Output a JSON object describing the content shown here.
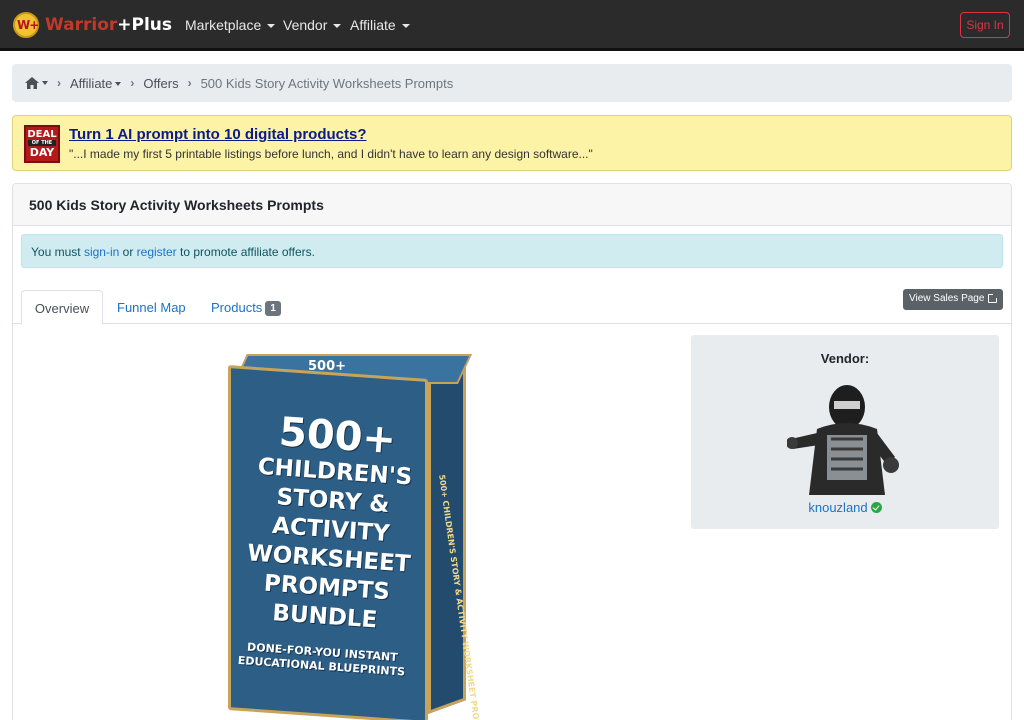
{
  "navbar": {
    "logo_mark": "W+",
    "brand_name": "Warrior",
    "brand_plus": "+Plus",
    "menu": [
      {
        "label": "Marketplace"
      },
      {
        "label": "Vendor"
      },
      {
        "label": "Affiliate"
      }
    ],
    "sign_in": "Sign In"
  },
  "breadcrumb": {
    "items": [
      {
        "label": "Affiliate"
      },
      {
        "label": "Offers"
      }
    ],
    "current": "500 Kids Story Activity Worksheets Prompts"
  },
  "deal": {
    "badge_line1": "DEAL",
    "badge_line2": "OF THE",
    "badge_line3": "DAY",
    "title": "Turn 1 AI prompt into 10 digital products?",
    "quote": "\"...I made my first 5 printable listings before lunch, and I didn't have to learn any design software...\""
  },
  "offer": {
    "title": "500 Kids Story Activity Worksheets Prompts",
    "alert_prefix": "You must",
    "alert_signin": "sign-in",
    "alert_or": "or",
    "alert_register": "register",
    "alert_suffix": "to promote affiliate offers.",
    "tabs": [
      {
        "label": "Overview",
        "active": true
      },
      {
        "label": "Funnel Map"
      },
      {
        "label": "Products",
        "badge": "1"
      }
    ],
    "view_sales_page": "View Sales Page"
  },
  "product_image": {
    "top_label": "500+",
    "number": "500+",
    "lines": [
      "CHILDREN'S",
      "STORY &",
      "ACTIVITY",
      "WORKSHEET",
      "PROMPTS",
      "BUNDLE"
    ],
    "subtitle_1": "DONE-FOR-YOU INSTANT",
    "subtitle_2": "EDUCATIONAL BLUEPRINTS",
    "side_text": "500+ CHILDREN'S STORY & ACTIVITY WORKSHEET PROMPTS BUNDLE"
  },
  "vendor": {
    "label": "Vendor:",
    "name": "knouzland"
  },
  "colors": {
    "navbar_bg": "#2b2b2b",
    "brand_red": "#c0392b",
    "link_blue": "#1a73c8",
    "deal_bg": "#fcf3a6",
    "alert_bg": "#d1ecf1",
    "verified_green": "#28a745"
  }
}
